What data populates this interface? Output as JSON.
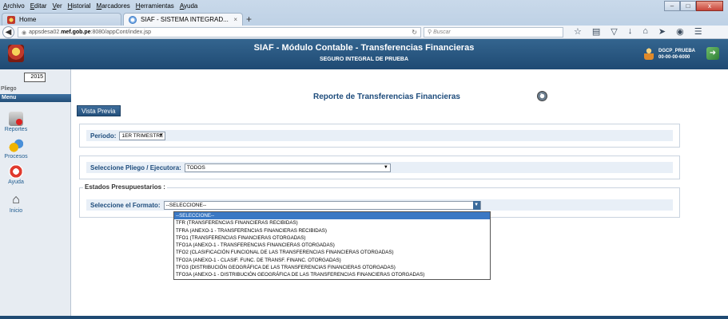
{
  "browser": {
    "menu": [
      "Archivo",
      "Editar",
      "Ver",
      "Historial",
      "Marcadores",
      "Herramientas",
      "Ayuda"
    ],
    "tabs": [
      {
        "label": "Home",
        "close": ""
      },
      {
        "label": "SIAF - SISTEMA INTEGRAD...",
        "close": "×"
      }
    ],
    "new_tab": "+",
    "url_prefix": "appsdesa02.",
    "url_host": "mef.gob.pe",
    "url_path": ":8080/appCont/index.jsp",
    "search_placeholder": "Buscar",
    "window_buttons": {
      "minimize": "–",
      "maximize": "□",
      "close": "x"
    }
  },
  "header": {
    "title": "SIAF - Módulo Contable - Transferencias Financieras",
    "subtitle": "SEGURO INTEGRAL DE PRUEBA",
    "user_name": "DGCP_PRUEBA",
    "user_code": "00-00-00-6000"
  },
  "sidebar": {
    "year": "2015",
    "pliego_label": "Pliego",
    "menu_label": "Menu",
    "items": [
      {
        "label": "Reportes",
        "icon": "reports-icon"
      },
      {
        "label": "Procesos",
        "icon": "processes-icon"
      },
      {
        "label": "Ayuda",
        "icon": "help-icon"
      },
      {
        "label": "Inicio",
        "icon": "home-icon"
      }
    ]
  },
  "main": {
    "page_title": "Reporte de Transferencias Financieras",
    "preview_button": "Vista Previa",
    "periodo": {
      "label": "Periodo:",
      "value": "1ER TRIMESTRE"
    },
    "pliego": {
      "label": "Seleccione Pliego / Ejecutora:",
      "value": "TODOS"
    },
    "estados_legend": "Estados Presupuestarios :",
    "formato": {
      "label": "Seleccione el Formato:",
      "value": "--SELECCIONE--",
      "options": [
        "--SELECCIONE--",
        "TFR (TRANSFERENCIAS FINANCIERAS RECIBIDAS)",
        "TFRA (ANEXO-1 - TRANSFERENCIAS FINANCIERAS RECIBIDAS)",
        "TFO1 (TRANSFERENCIAS FINANCIERAS OTORGADAS)",
        "TFO1A (ANEXO-1 - TRANSFERENCIAS FINANCIERAS OTORGADAS)",
        "TFO2 (CLASIFICACIÓN FUNCIONAL DE LAS TRANSFERENCIAS FINANCIERAS OTORGADAS)",
        "TFO2A (ANEXO-1 - CLASIF. FUNC. DE TRANSF. FINANC. OTORGADAS)",
        "TFO3 (DISTRIBUCIÓN GEOGRÁFICA DE LAS TRANSFERENCIAS FINANCIERAS OTORGADAS)",
        "TFO3A (ANEXO-1 - DISTRIBUCIÓN GEOGRÁFICA DE LAS TRANSFERENCIAS FINANCIERAS OTORGADAS)"
      ]
    }
  }
}
